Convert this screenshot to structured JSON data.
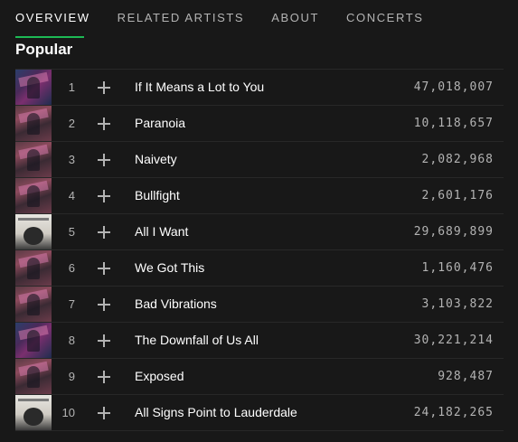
{
  "tabs": [
    {
      "label": "OVERVIEW",
      "active": true
    },
    {
      "label": "RELATED ARTISTS",
      "active": false
    },
    {
      "label": "ABOUT",
      "active": false
    },
    {
      "label": "CONCERTS",
      "active": false
    }
  ],
  "accent_color": "#1db954",
  "section": {
    "title": "Popular"
  },
  "tracks": [
    {
      "number": "1",
      "title": "If It Means a Lot to You",
      "plays": "47,018,007",
      "art": "album-blue-purple"
    },
    {
      "number": "2",
      "title": "Paranoia",
      "plays": "10,118,657",
      "art": "album-pink-maroon"
    },
    {
      "number": "3",
      "title": "Naivety",
      "plays": "2,082,968",
      "art": "album-pink-maroon"
    },
    {
      "number": "4",
      "title": "Bullfight",
      "plays": "2,601,176",
      "art": "album-pink-maroon"
    },
    {
      "number": "5",
      "title": "All I Want",
      "plays": "29,689,899",
      "art": "album-white-bird"
    },
    {
      "number": "6",
      "title": "We Got This",
      "plays": "1,160,476",
      "art": "album-pink-maroon"
    },
    {
      "number": "7",
      "title": "Bad Vibrations",
      "plays": "3,103,822",
      "art": "album-pink-maroon"
    },
    {
      "number": "8",
      "title": "The Downfall of Us All",
      "plays": "30,221,214",
      "art": "album-blue-purple"
    },
    {
      "number": "9",
      "title": "Exposed",
      "plays": "928,487",
      "art": "album-pink-maroon"
    },
    {
      "number": "10",
      "title": "All Signs Point to Lauderdale",
      "plays": "24,182,265",
      "art": "album-white-bird"
    }
  ]
}
